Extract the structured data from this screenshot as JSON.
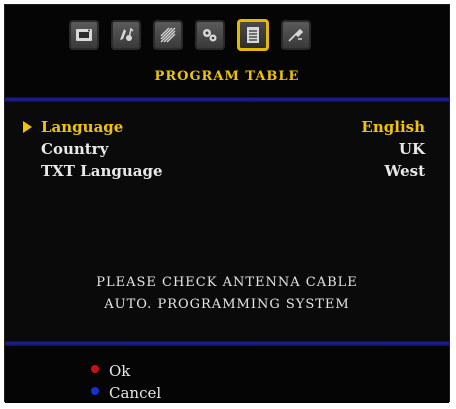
{
  "menu": {
    "title": "PROGRAM TABLE",
    "icons": [
      {
        "name": "picture-icon",
        "active": false
      },
      {
        "name": "sound-icon",
        "active": false
      },
      {
        "name": "feature-icon",
        "active": false
      },
      {
        "name": "install-icon",
        "active": false
      },
      {
        "name": "program-table-icon",
        "active": true
      },
      {
        "name": "source-icon",
        "active": false
      }
    ],
    "accent_color": "#f2c400",
    "separator_color": "#1e1e9c"
  },
  "settings": [
    {
      "label": "Language",
      "value": "English",
      "selected": true
    },
    {
      "label": "Country",
      "value": "UK",
      "selected": false
    },
    {
      "label": "TXT Language",
      "value": "West",
      "selected": false
    }
  ],
  "messages": {
    "line1": "PLEASE CHECK ANTENNA CABLE",
    "line2": "AUTO. PROGRAMMING SYSTEM"
  },
  "footer": {
    "ok_label": "Ok",
    "ok_color": "#cc1010",
    "cancel_label": "Cancel",
    "cancel_color": "#1a2fd0"
  }
}
